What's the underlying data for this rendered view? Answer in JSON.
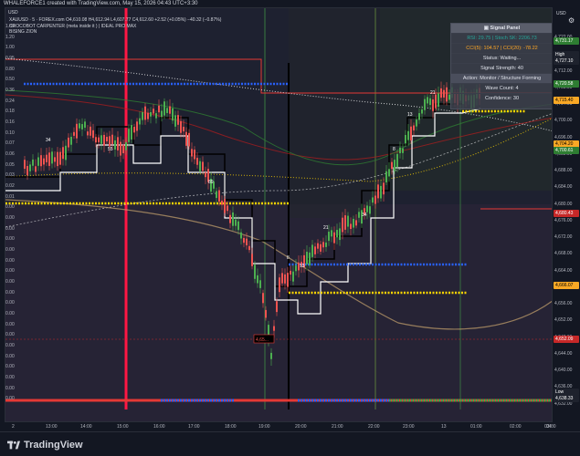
{
  "top_caption": "WHALEFORCE1 created with TradingView.com, May 15, 2026 04:43 UTC+3:30",
  "header": {
    "symbol_line": "XAUUSD · 5 · FOREX.com  O4,610.08  H4,612.94  L4,607.77  C4,612.60  +2.52 (+0.05%)  −40.32 (−0.87%)",
    "indicator1": "CROCOBOT CARPENTER (meta inside it ) | IDEAL PRO MAX",
    "indicator2": "BISING ZION"
  },
  "currency_left": "USD",
  "currency_right": "USD",
  "left_axis": [
    "1.80",
    "1.20",
    "1.00",
    "0.95",
    "0.80",
    "0.50",
    "0.36",
    "0.24",
    "0.18",
    "0.16",
    "0.10",
    "0.07",
    "0.06",
    "0.05",
    "0.03",
    "0.02",
    "0.01",
    "0.00",
    "0.00",
    "0.00",
    "0.00",
    "0.00",
    "0.00",
    "0.00",
    "0.00",
    "0.00",
    "0.00",
    "0.00",
    "0.00",
    "0.00",
    "0.00",
    "0.00",
    "0.00",
    "0.00",
    "0.00",
    "0.00"
  ],
  "right_axis": [
    "4,722.00",
    "4,716.00",
    "4,712.00",
    "4,708.00",
    "4,704.00",
    "4,700.00",
    "4,696.00",
    "4,692.00",
    "4,688.00",
    "4,684.00",
    "4,680.00",
    "4,676.00",
    "4,672.00",
    "4,668.00",
    "4,664.00",
    "4,660.00",
    "4,656.00",
    "4,652.00",
    "4,648.00",
    "4,644.00",
    "4,640.00",
    "4,636.00",
    "4,632.00"
  ],
  "price_tags": [
    {
      "text": "4,731.17",
      "color": "#2e7d32"
    },
    {
      "text": "High",
      "color": "#1e222d"
    },
    {
      "text": "4,727.10",
      "color": "#1e222d"
    },
    {
      "text": "4,720.58",
      "color": "#2e7d32"
    },
    {
      "text": "4,715.40",
      "color": "#f9a825"
    },
    {
      "text": "4,704.20",
      "color": "#f9a825"
    },
    {
      "text": "4,700.61",
      "color": "#2e7d32"
    },
    {
      "text": "4,680.43",
      "color": "#c62828"
    },
    {
      "text": "4,666.07",
      "color": "#f9a825"
    },
    {
      "text": "4,652.09",
      "color": "#c62828"
    },
    {
      "text": "Low",
      "color": "#1e222d"
    },
    {
      "text": "4,638.33",
      "color": "#1e222d"
    }
  ],
  "time_axis": [
    "2",
    "13:00",
    "14:00",
    "15:00",
    "16:00",
    "17:00",
    "18:00",
    "19:00",
    "20:00",
    "21:00",
    "22:00",
    "23:00",
    "13",
    "01:00",
    "02:00",
    "03:00",
    "04:"
  ],
  "signal_panel": {
    "title": "Signal Panel",
    "rsi": "RSI: 29.75 | Stoch SK: 2206.73",
    "cci": "CCI(5): 104.57 | CCI(20): -78.22",
    "status": "Status: Waiting...",
    "strength": "Signal Strength: 40",
    "action": "Action: Monitor / Structure Forming",
    "wave": "Wave Count: 4",
    "confidence": "Confidence: 30"
  },
  "chart_labels": [
    "34",
    "55",
    "89",
    "8",
    "13",
    "21",
    "34",
    "8",
    "13",
    "21"
  ],
  "price_label_box": "4,65...",
  "brand": "TradingView",
  "colors": {
    "bull": "#26a69a",
    "bull_bright": "#4caf50",
    "bear": "#ef5350",
    "blue_dots": "#2962ff",
    "yellow_dots": "#ffd600",
    "bg": "#131722"
  }
}
